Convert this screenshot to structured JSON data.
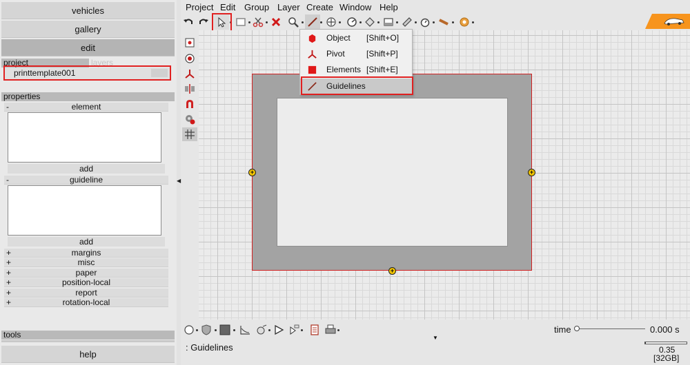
{
  "nav": {
    "vehicles": "vehicles",
    "gallery": "gallery",
    "edit": "edit",
    "help": "help"
  },
  "project_tabs": {
    "project": "project",
    "layers": "layers"
  },
  "project_item": "printtemplate001",
  "properties": {
    "header": "properties",
    "element_sign": "-",
    "element": "element",
    "element_add": "add",
    "guideline_sign": "-",
    "guideline": "guideline",
    "guideline_add": "add",
    "groups": [
      {
        "sign": "+",
        "label": "margins"
      },
      {
        "sign": "+",
        "label": "misc"
      },
      {
        "sign": "+",
        "label": "paper"
      },
      {
        "sign": "+",
        "label": "position-local"
      },
      {
        "sign": "+",
        "label": "report"
      },
      {
        "sign": "+",
        "label": "rotation-local"
      }
    ]
  },
  "tools_header": "tools",
  "menubar": [
    "Project",
    "Edit",
    "Group",
    "Layer",
    "Create",
    "Window",
    "Help"
  ],
  "toolbar_icons": [
    "undo-icon",
    "redo-icon",
    "select-arrow-icon",
    "rectangle-icon",
    "cut-icon",
    "delete-icon",
    "zoom-icon",
    "guideline-pen-icon",
    "move-icon",
    "snap-icon",
    "tag-icon",
    "window-icon",
    "ruler-icon",
    "clock-icon",
    "pencil-icon",
    "help-circle-icon"
  ],
  "dropdown": {
    "items": [
      {
        "label": "Object",
        "shortcut": "[Shift+O]",
        "icon": "object-cube-icon"
      },
      {
        "label": "Pivot",
        "shortcut": "[Shift+P]",
        "icon": "pivot-icon"
      },
      {
        "label": "Elements",
        "shortcut": "[Shift+E]",
        "icon": "elements-square-icon"
      },
      {
        "label": "Guidelines",
        "shortcut": "",
        "icon": "guideline-icon",
        "selected": true
      }
    ]
  },
  "status_text": ": Guidelines",
  "timeline": {
    "label": "time",
    "value": "0.000 s",
    "position": 0
  },
  "memory": {
    "value": "0.35",
    "total": "[32GB]"
  },
  "colors": {
    "accent": "#f7941d",
    "highlight_red": "#e02020",
    "handle": "#f2c400",
    "frame": "#a3a3a3"
  }
}
